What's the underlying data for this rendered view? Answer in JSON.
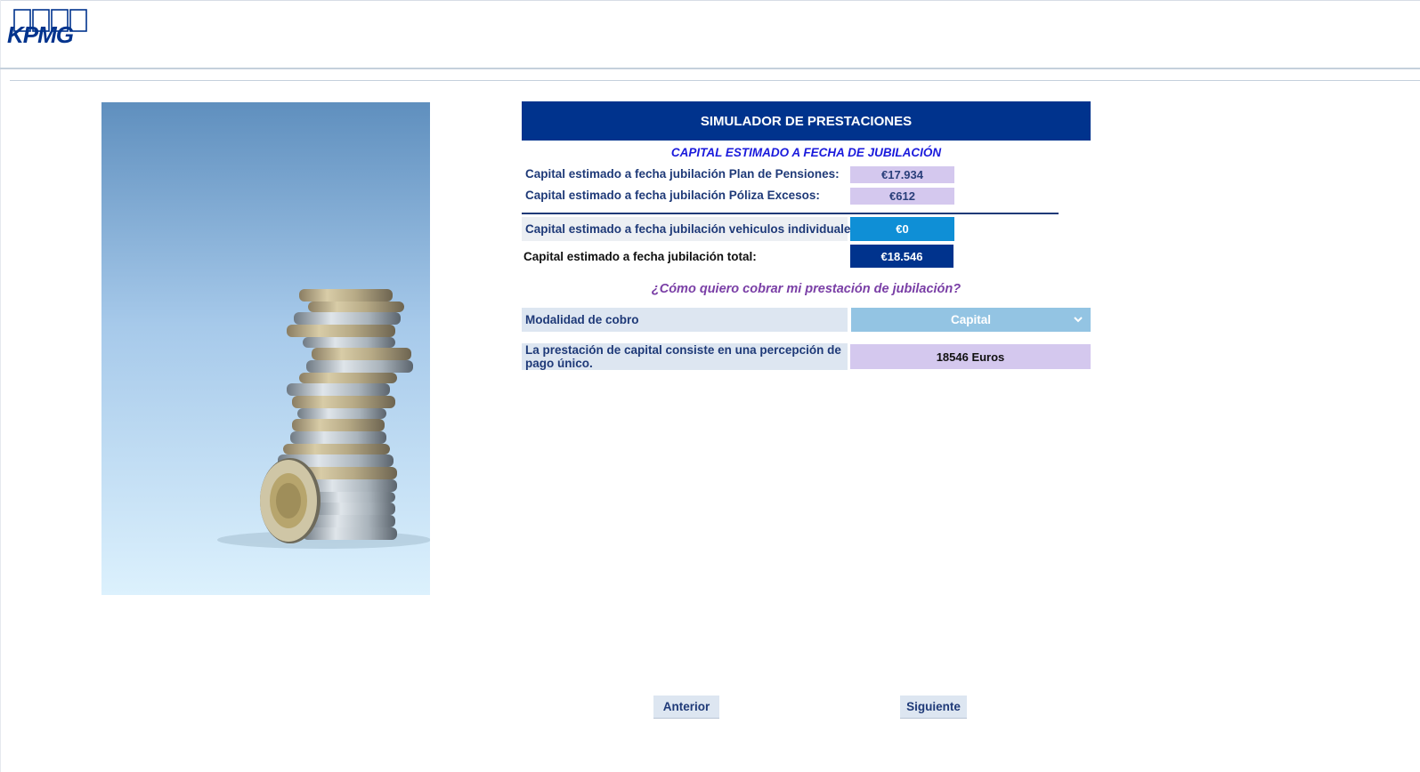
{
  "header": {
    "logo_text": "KPMG"
  },
  "panel": {
    "title": "SIMULADOR DE PRESTACIONES",
    "subtitle": "CAPITAL ESTIMADO A FECHA DE JUBILACIÓN",
    "rows": [
      {
        "label": "Capital estimado a fecha jubilación Plan de Pensiones:",
        "value": "€17.934"
      },
      {
        "label": "Capital estimado a fecha jubilación Póliza Excesos:",
        "value": "€612"
      },
      {
        "label": "Capital estimado a fecha jubilación vehiculos individuales:",
        "value": "€0"
      },
      {
        "label": "Capital estimado a fecha jubilación total:",
        "value": "€18.546"
      }
    ],
    "question": "¿Cómo quiero cobrar mi prestación de jubilación?",
    "modalidad": {
      "label": "Modalidad de cobro",
      "selected": "Capital"
    },
    "description": {
      "line1": "La prestación de capital consiste en una percepción de",
      "line2": "pago único.",
      "value": "18546 Euros"
    }
  },
  "nav": {
    "prev_label": "Anterior",
    "next_label": "Siguiente"
  },
  "colors": {
    "brand_navy": "#00338d",
    "accent_blue": "#0f8fd6",
    "lilac": "#d4c8ee",
    "select_blue": "#93c4e3",
    "question_purple": "#7a3fa6"
  },
  "icons": [
    "kpmg-logo",
    "chevron-down-icon"
  ]
}
